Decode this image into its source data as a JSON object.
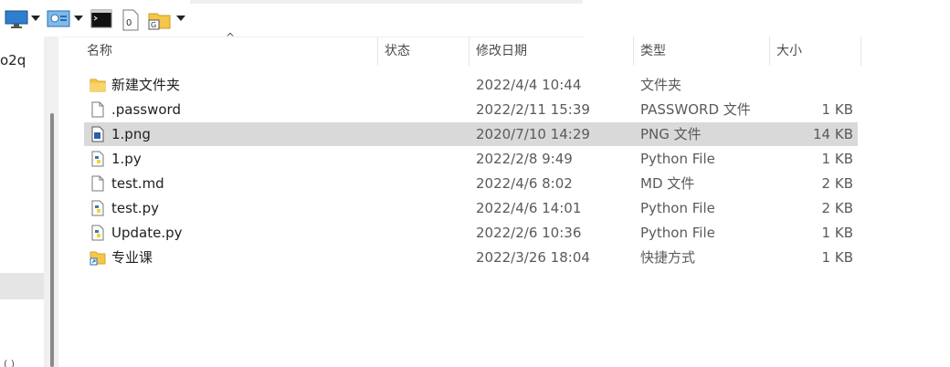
{
  "nav": {
    "partial_label": "o2q",
    "bottom_partial": "( )"
  },
  "columns": {
    "name": "名称",
    "status": "状态",
    "modified": "修改日期",
    "type": "类型",
    "size": "大小"
  },
  "files": [
    {
      "name": "新建文件夹",
      "date": "2022/4/4 10:44",
      "type": "文件夹",
      "size": "",
      "icon": "folder-icon"
    },
    {
      "name": ".password",
      "date": "2022/2/11 15:39",
      "type": "PASSWORD 文件",
      "size": "1 KB",
      "icon": "file-icon"
    },
    {
      "name": "1.png",
      "date": "2020/7/10 14:29",
      "type": "PNG 文件",
      "size": "14 KB",
      "icon": "image-file-icon",
      "selected": true
    },
    {
      "name": "1.py",
      "date": "2022/2/8 9:49",
      "type": "Python File",
      "size": "1 KB",
      "icon": "python-file-icon"
    },
    {
      "name": "test.md",
      "date": "2022/4/6 8:02",
      "type": "MD 文件",
      "size": "2 KB",
      "icon": "file-icon"
    },
    {
      "name": "test.py",
      "date": "2022/4/6 14:01",
      "type": "Python File",
      "size": "2 KB",
      "icon": "python-file-icon"
    },
    {
      "name": "Update.py",
      "date": "2022/2/6 10:36",
      "type": "Python File",
      "size": "1 KB",
      "icon": "python-file-icon"
    },
    {
      "name": "专业课",
      "date": "2022/3/26 18:04",
      "type": "快捷方式",
      "size": "1 KB",
      "icon": "shortcut-folder-icon"
    }
  ],
  "colors": {
    "selected_row": "#d9d9d9",
    "folder": "#f4c64a",
    "python_blue": "#3b75b0",
    "python_yellow": "#f6d33c"
  }
}
